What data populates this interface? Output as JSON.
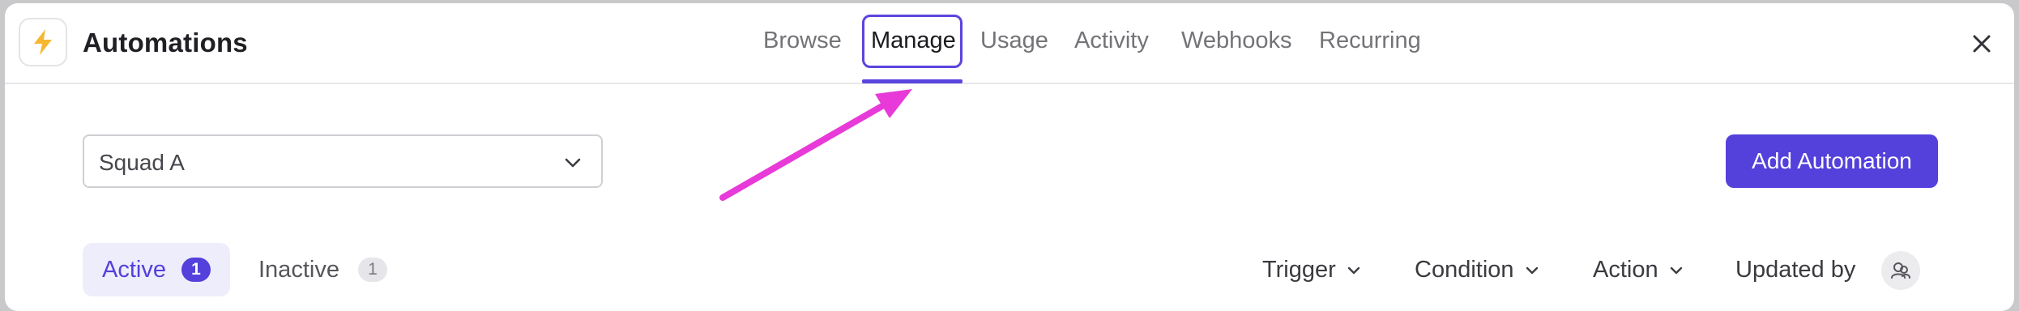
{
  "app": {
    "title": "Automations",
    "icon": "lightning-bolt-icon"
  },
  "tabs": [
    {
      "label": "Browse",
      "active": false
    },
    {
      "label": "Manage",
      "active": true
    },
    {
      "label": "Usage",
      "active": false
    },
    {
      "label": "Activity",
      "active": false
    },
    {
      "label": "Webhooks",
      "active": false
    },
    {
      "label": "Recurring",
      "active": false
    }
  ],
  "close_icon": "close-icon",
  "team_select": {
    "value": "Squad A",
    "icon": "chevron-down-icon"
  },
  "add_button": {
    "label": "Add Automation"
  },
  "status_filters": [
    {
      "label": "Active",
      "count": "1",
      "selected": true
    },
    {
      "label": "Inactive",
      "count": "1",
      "selected": false
    }
  ],
  "filters": {
    "trigger": "Trigger",
    "condition": "Condition",
    "action": "Action",
    "updated_by": "Updated by"
  },
  "annotation": {
    "type": "arrow",
    "color": "#e83ad8",
    "points_to": "Manage tab"
  },
  "colors": {
    "accent": "#5440db",
    "bolt": "#f5b731",
    "annotation": "#e83ad8"
  }
}
